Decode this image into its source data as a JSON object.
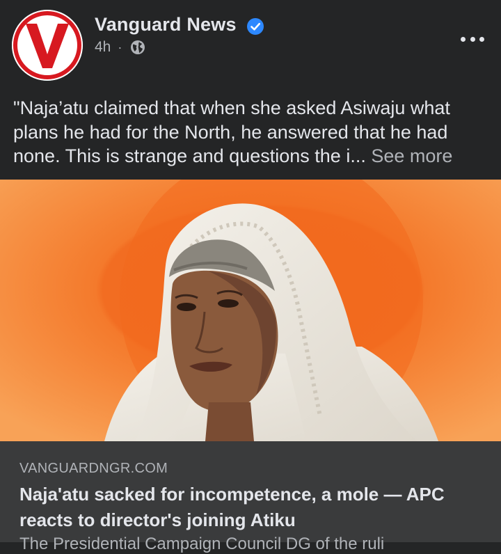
{
  "post": {
    "page_name": "Vanguard News",
    "time": "4h",
    "separator": "·",
    "audience_icon": "globe-icon",
    "verified_icon": "verified-badge-icon",
    "more_icon": "more-options-icon",
    "caption_lines": [
      "\"Naja’atu claimed that when she asked Asiwaju what",
      "plans he had for the North, he answered that he had",
      "none. This is strange and questions the i..."
    ],
    "see_more": "See more"
  },
  "avatar": {
    "letter": "V",
    "colors": {
      "ring": "#d71920",
      "letter": "#d71920"
    }
  },
  "link_preview": {
    "domain": "VANGUARDNGR.COM",
    "headline": "Naja'atu sacked for incompetence, a mole — APC reacts to director's joining Atiku",
    "snippet": "The Presidential Campaign Council DG of the ruli"
  },
  "colors": {
    "background": "#242526",
    "preview_background": "#3a3b3c",
    "verified": "#2d88ff",
    "photo_background": "#f57a2b"
  }
}
